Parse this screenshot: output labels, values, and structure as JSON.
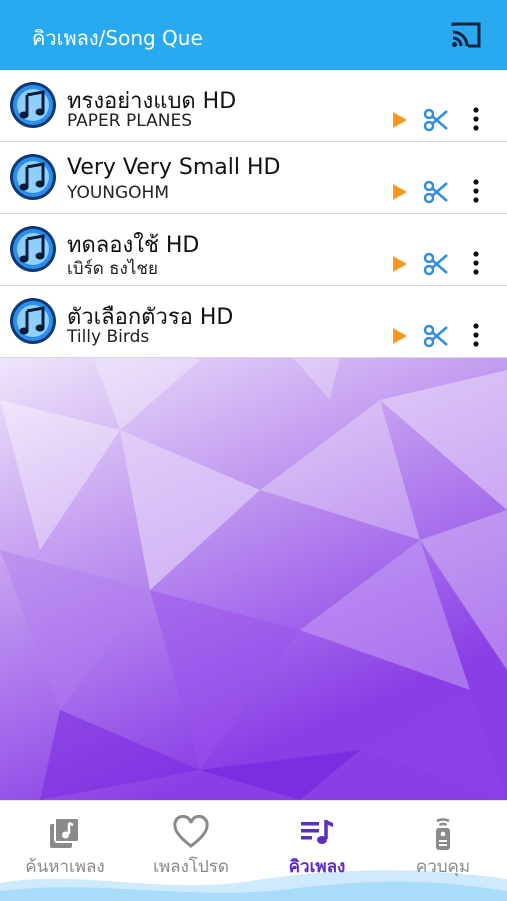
{
  "app_bar": {
    "title": "คิวเพลง/Song Que",
    "cast_icon": "cast-icon"
  },
  "queue": [
    {
      "title": "ทรงอย่างแบด HD",
      "artist": "PAPER PLANES"
    },
    {
      "title": "Very Very Small HD",
      "artist": "YOUNGOHM"
    },
    {
      "title": "ทดลองใช้ HD",
      "artist": "เบิร์ด ธงไชย"
    },
    {
      "title": "ตัวเลือกตัวรอ HD",
      "artist": "Tilly Birds"
    }
  ],
  "row_icons": {
    "song": "music-note-icon",
    "play": "play-icon",
    "cut": "scissors-icon",
    "more": "more-vertical-icon"
  },
  "nav": [
    {
      "label": "ค้นหาเพลง",
      "icon": "music-library-icon",
      "active": false
    },
    {
      "label": "เพลงโปรด",
      "icon": "heart-icon",
      "active": false
    },
    {
      "label": "คิวเพลง",
      "icon": "queue-music-icon",
      "active": true
    },
    {
      "label": "ควบคุม",
      "icon": "remote-icon",
      "active": false
    }
  ],
  "colors": {
    "app_bar": "#29a9ef",
    "play": "#f29a1b",
    "cut": "#2f8de4",
    "active_nav": "#5b2ec2",
    "inactive_nav": "#8a8a8a"
  }
}
